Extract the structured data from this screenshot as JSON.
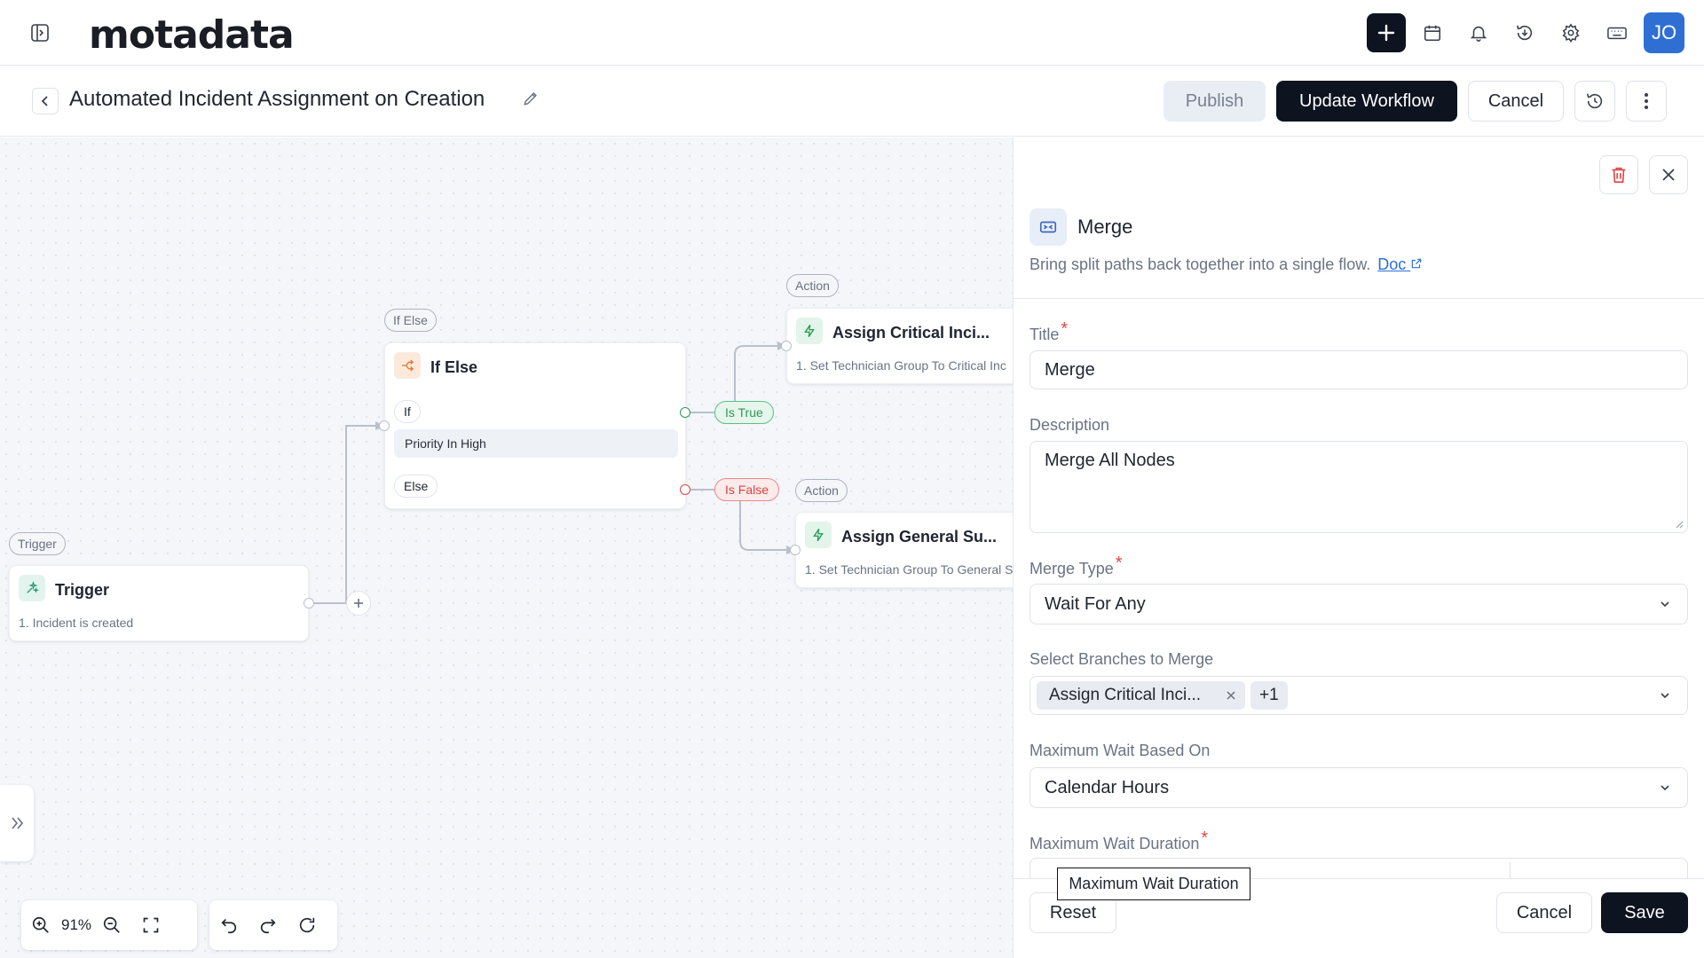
{
  "app": {
    "logo": "motadata",
    "avatar_initials": "JO"
  },
  "header": {
    "title": "Automated Incident Assignment on Creation",
    "publish_label": "Publish",
    "update_label": "Update Workflow",
    "cancel_label": "Cancel"
  },
  "canvas": {
    "trigger": {
      "badge": "Trigger",
      "title": "Trigger",
      "sub": "1. Incident is created"
    },
    "ifelse": {
      "badge": "If Else",
      "title": "If Else",
      "if_label": "If",
      "condition": "Priority In High",
      "else_label": "Else"
    },
    "true_pill": "Is True",
    "false_pill": "Is False",
    "action1": {
      "badge": "Action",
      "title": "Assign Critical Inci...",
      "sub": "1. Set Technician Group To Critical Inc"
    },
    "action2": {
      "badge": "Action",
      "title": "Assign General Su...",
      "sub": "1. Set Technician Group To General S"
    },
    "zoom": "91%"
  },
  "panel": {
    "title": "Merge",
    "description": "Bring split paths back together into a single flow.",
    "doc_label": "Doc",
    "fields": {
      "title_label": "Title",
      "title_value": "Merge",
      "description_label": "Description",
      "description_value": "Merge All Nodes",
      "merge_type_label": "Merge Type",
      "merge_type_value": "Wait For Any",
      "branches_label": "Select Branches to Merge",
      "branch_tag": "Assign Critical Inci...",
      "branch_more": "+1",
      "wait_based_label": "Maximum Wait Based On",
      "wait_based_value": "Calendar Hours",
      "wait_duration_label": "Maximum Wait Duration"
    },
    "tooltip": "Maximum Wait Duration",
    "reset_label": "Reset",
    "cancel_label": "Cancel",
    "save_label": "Save"
  },
  "colors": {
    "primary_dark": "#0e1320",
    "accent_blue": "#2f6fd4",
    "true_green": "#2c9a55",
    "false_red": "#d64545"
  }
}
